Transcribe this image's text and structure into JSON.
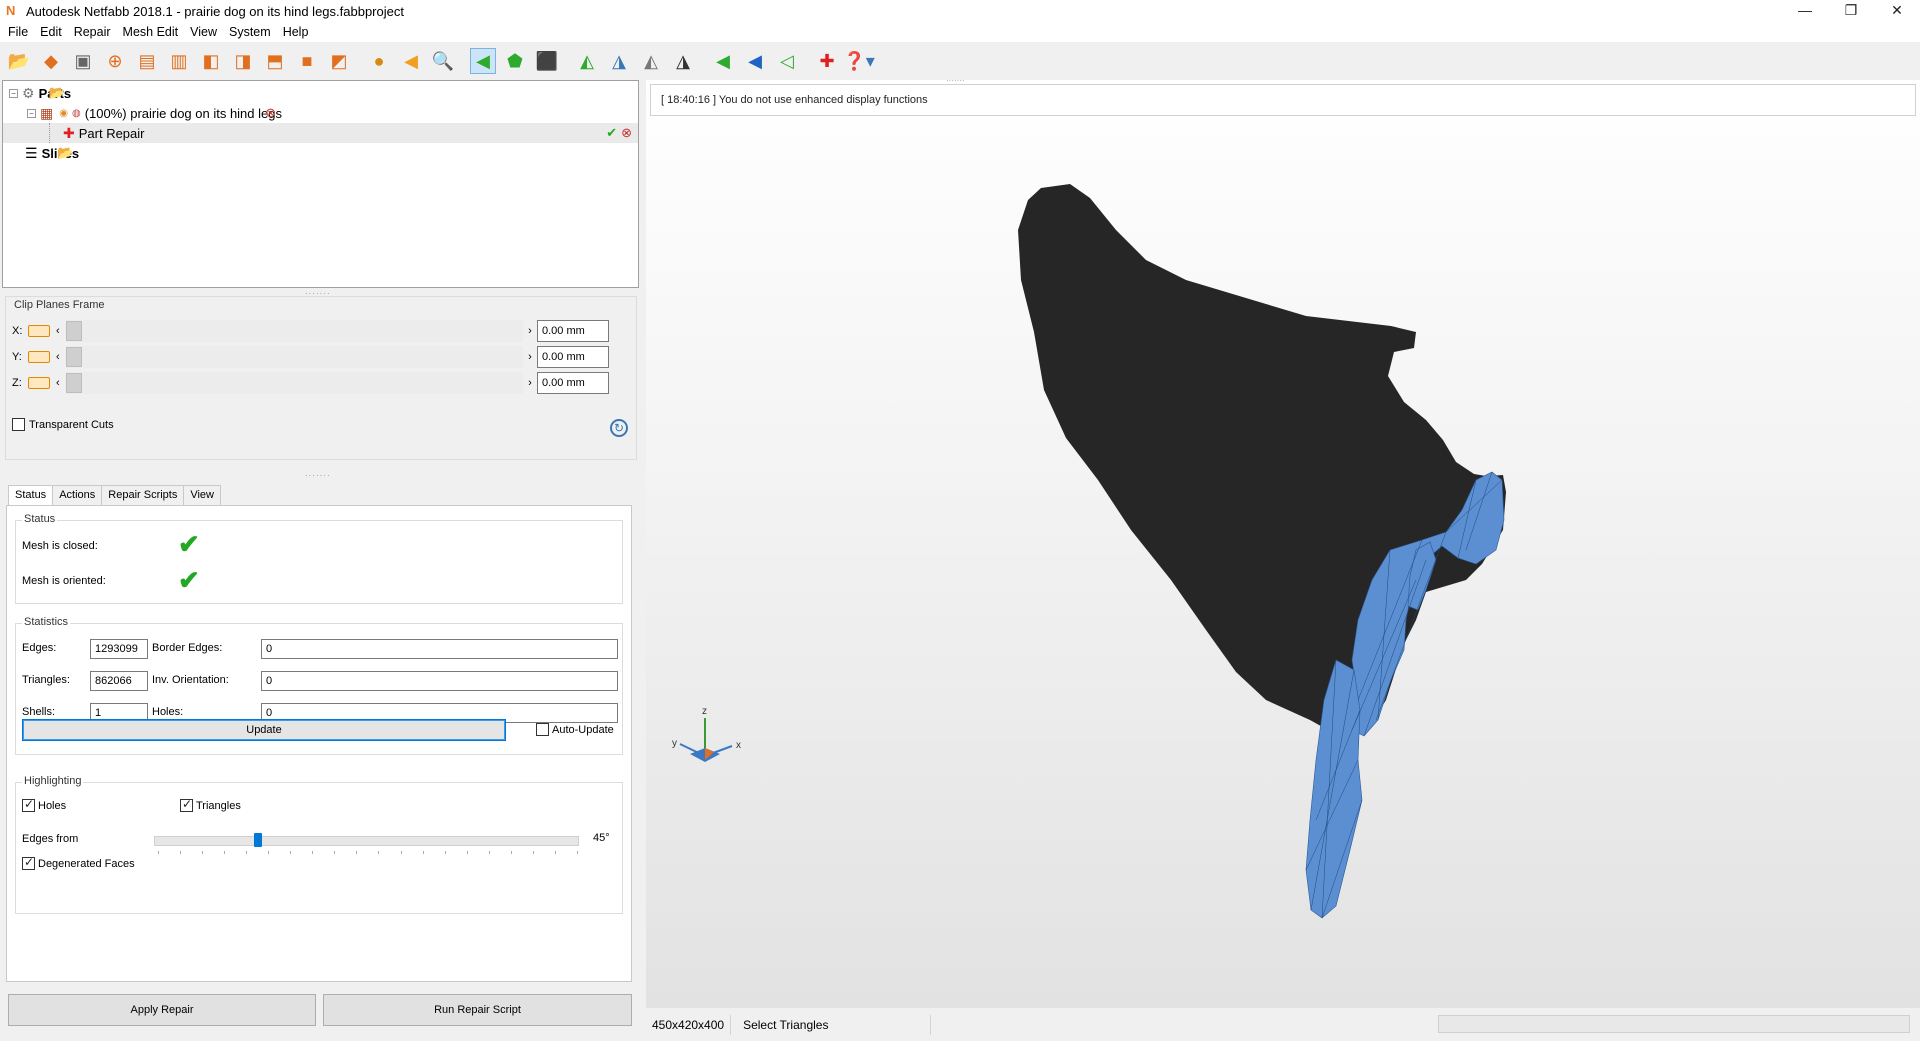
{
  "window": {
    "title": "Autodesk Netfabb 2018.1 - prairie dog on its hind legs.fabbproject",
    "app_icon": "N",
    "controls": [
      "—",
      "❐",
      "✕"
    ]
  },
  "menu": [
    "File",
    "Edit",
    "Repair",
    "Mesh Edit",
    "View",
    "System",
    "Help"
  ],
  "parts_tree": {
    "root_label": "Parts",
    "part_label": "(100%) prairie dog on its hind legs",
    "repair_label": "Part Repair",
    "slices_label": "Slices"
  },
  "clip_planes": {
    "title": "Clip Planes Frame",
    "rows": [
      {
        "axis": "X:",
        "value": "0.00 mm"
      },
      {
        "axis": "Y:",
        "value": "0.00 mm"
      },
      {
        "axis": "Z:",
        "value": "0.00 mm"
      }
    ],
    "transparent_cuts_label": "Transparent Cuts",
    "transparent_cuts_checked": false
  },
  "tabs": [
    "Status",
    "Actions",
    "Repair Scripts",
    "View"
  ],
  "active_tab": "Status",
  "status_group": {
    "title": "Status",
    "mesh_closed_label": "Mesh is closed:",
    "mesh_oriented_label": "Mesh is oriented:"
  },
  "statistics": {
    "title": "Statistics",
    "edges_label": "Edges:",
    "edges_value": "1293099",
    "border_edges_label": "Border Edges:",
    "border_edges_value": "0",
    "triangles_label": "Triangles:",
    "triangles_value": "862066",
    "inv_orientation_label": "Inv. Orientation:",
    "inv_orientation_value": "0",
    "shells_label": "Shells:",
    "shells_value": "1",
    "holes_label": "Holes:",
    "holes_value": "0",
    "update_label": "Update",
    "auto_update_label": "Auto-Update"
  },
  "highlighting": {
    "title": "Highlighting",
    "holes_label": "Holes",
    "triangles_label": "Triangles",
    "edges_from_label": "Edges from",
    "edges_from_value": "45°",
    "degenerated_label": "Degenerated Faces"
  },
  "buttons": {
    "apply_repair": "Apply Repair",
    "run_repair_script": "Run Repair Script"
  },
  "viewport": {
    "log_message": "[ 18:40:16 ] You do not use enhanced display functions",
    "axis_labels": {
      "x": "x",
      "y": "y",
      "z": "z"
    }
  },
  "statusbar": {
    "dimensions": "450x420x400",
    "mode": "Select Triangles"
  },
  "colors": {
    "mesh_dark": "#262626",
    "mesh_highlight": "#5b8fd1",
    "accent": "#0078d7"
  }
}
